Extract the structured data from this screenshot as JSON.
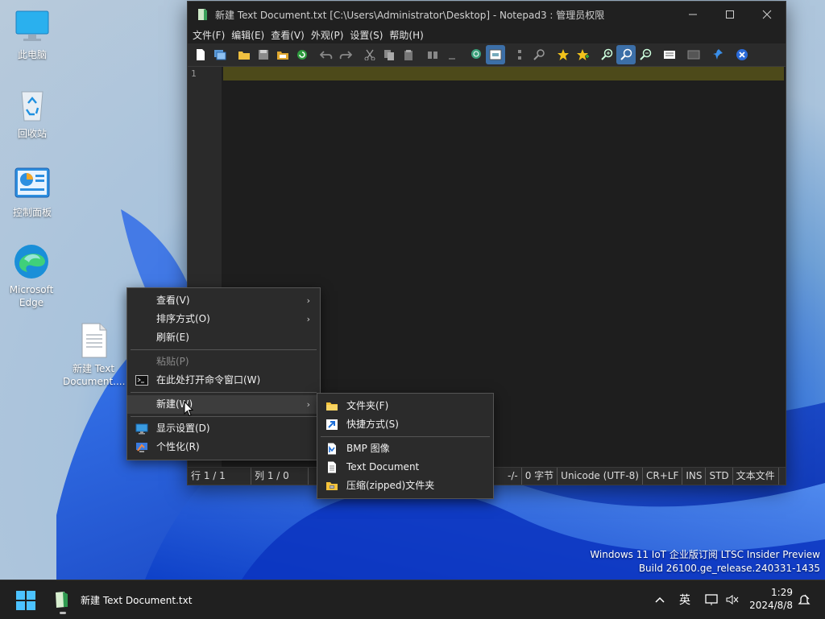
{
  "desktop": {
    "icons": [
      {
        "label": "此电脑"
      },
      {
        "label": "回收站"
      },
      {
        "label": "控制面板"
      },
      {
        "label": "Microsoft Edge"
      },
      {
        "label": "新建 Text Document...."
      }
    ]
  },
  "notepad": {
    "title": "新建 Text Document.txt [C:\\Users\\Administrator\\Desktop] - Notepad3 : 管理员权限",
    "menu": [
      "文件(F)",
      "编辑(E)",
      "查看(V)",
      "外观(P)",
      "设置(S)",
      "帮助(H)"
    ],
    "line_number": "1",
    "status": {
      "line": "行  1 / 1",
      "col": "列  1 / 0",
      "sel": "-/-",
      "bytes": "0 字节",
      "encoding": "Unicode (UTF-8)",
      "eol": "CR+LF",
      "ins": "INS",
      "std": "STD",
      "lexer": "文本文件"
    }
  },
  "context_menu": {
    "items": [
      {
        "label": "查看(V)"
      },
      {
        "label": "排序方式(O)"
      },
      {
        "label": "刷新(E)"
      },
      {
        "label": "粘贴(P)"
      },
      {
        "label": "在此处打开命令窗口(W)"
      },
      {
        "label": "新建(W)"
      },
      {
        "label": "显示设置(D)"
      },
      {
        "label": "个性化(R)"
      }
    ]
  },
  "submenu_new": {
    "items": [
      {
        "label": "文件夹(F)"
      },
      {
        "label": "快捷方式(S)"
      },
      {
        "label": "BMP 图像"
      },
      {
        "label": "Text Document"
      },
      {
        "label": "压缩(zipped)文件夹"
      }
    ]
  },
  "watermark": {
    "line1": "Windows 11 IoT 企业版订阅 LTSC Insider Preview",
    "line2": "Build 26100.ge_release.240331-1435"
  },
  "taskbar": {
    "app_label": "新建 Text Document.txt",
    "ime": "英",
    "time": "1:29",
    "date": "2024/8/8"
  }
}
